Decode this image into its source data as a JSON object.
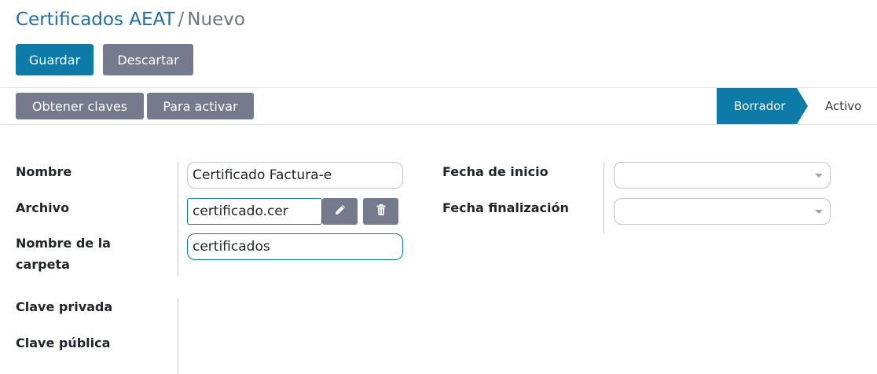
{
  "breadcrumb": {
    "parent": "Certificados AEAT",
    "separator": "/",
    "current": "Nuevo"
  },
  "toolbar": {
    "save_label": "Guardar",
    "discard_label": "Descartar"
  },
  "actions": {
    "get_keys_label": "Obtener claves",
    "activate_label": "Para activar"
  },
  "statusbar": {
    "stages": [
      "Borrador",
      "Activo"
    ],
    "active_stage": "Borrador"
  },
  "form": {
    "name_label": "Nombre",
    "name_value": "Certificado Factura-e",
    "file_label": "Archivo",
    "file_value": "certificado.cer",
    "folder_label_line1": "Nombre de la",
    "folder_label_line2": "carpeta",
    "folder_value": "certificados",
    "private_key_label": "Clave privada",
    "public_key_label": "Clave pública",
    "start_date_label": "Fecha de inicio",
    "start_date_value": "",
    "end_date_label": "Fecha finalización",
    "end_date_value": ""
  },
  "icons": {
    "edit": "pencil-icon",
    "delete": "trash-icon",
    "dropdown": "caret-down-icon"
  },
  "colors": {
    "primary": "#0d7aa8",
    "secondary": "#757a8c",
    "link": "#1f6f9e"
  }
}
